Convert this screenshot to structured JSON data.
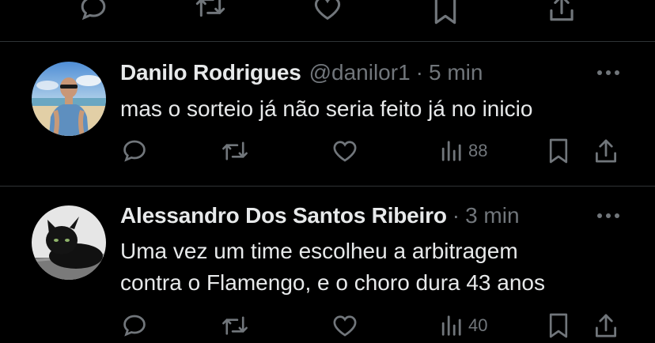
{
  "posts": [
    {
      "name": "Danilo Rodrigues",
      "handle": "@danilor1",
      "separator": "·",
      "time": "5 min",
      "text": "mas o sorteio já não seria feito já no inicio",
      "views": "88"
    },
    {
      "name": "Alessandro Dos Santos Ribeiro",
      "separator": "·",
      "time": "3 min",
      "text_lines": [
        "Uma vez um time escolheu a arbitragem",
        "contra o Flamengo, e o choro dura 43 anos"
      ],
      "views": "40"
    }
  ],
  "icons": [
    "reply-icon",
    "repost-icon",
    "like-icon",
    "views-icon",
    "bookmark-icon",
    "share-icon",
    "more-icon"
  ],
  "colors": {
    "background": "#000000",
    "text_primary": "#e7e9ea",
    "text_secondary": "#71767b",
    "divider": "#2f3336"
  }
}
